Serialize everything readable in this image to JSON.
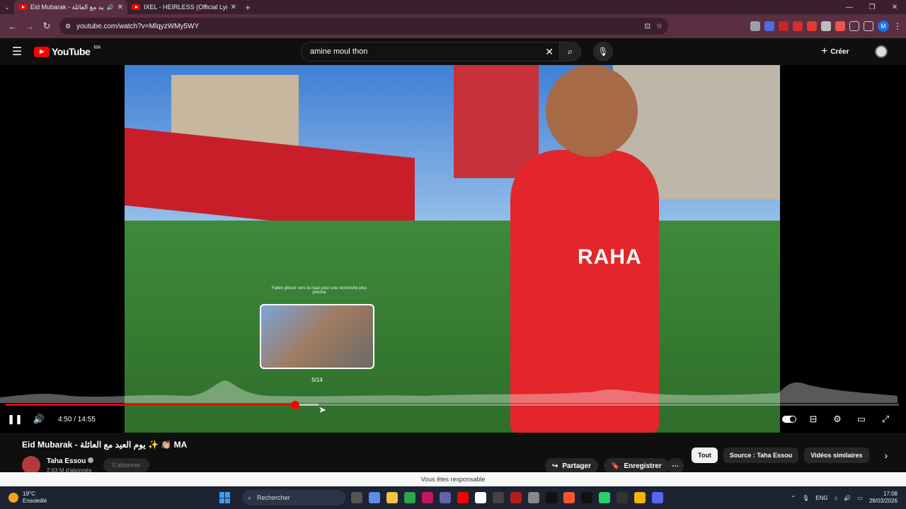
{
  "browser": {
    "tabs": [
      {
        "title": "Eid Mubarak - يوم العيد مع العائلة",
        "active": true
      },
      {
        "title": "IXEL - HEIRLESS (Official Lyric V",
        "active": false
      }
    ],
    "url": "youtube.com/watch?v=MlqyzWMy5WY",
    "profile_initial": "M"
  },
  "youtube": {
    "logo_text": "YouTube",
    "country_code": "MA",
    "search_value": "amine moul thon",
    "create_label": "Créer"
  },
  "player": {
    "hover_hint": "Faites glisser vers le haut pour une recherche plus précise",
    "preview_chapter": "5/14",
    "current_time": "4:50",
    "duration": "14:55",
    "time_display": "4:50 / 14:55",
    "progress_fraction": 0.324,
    "buffer_fraction": 0.35,
    "jersey_text": "RAHA"
  },
  "video": {
    "title": "Eid Mubarak - يوم العيد مع العائلة ✨ 👏🏼 MA",
    "channel_name": "Taha Essou",
    "subscribers": "2,63 M d'abonnés",
    "subscribe_label": "S'abonner",
    "share_label": "Partager",
    "save_label": "Enregistrer"
  },
  "chips": [
    "Tout",
    "Source : Taha Essou",
    "Vidéos similaires"
  ],
  "notice": "Vous êtes responsable",
  "taskbar": {
    "temperature": "19°C",
    "condition": "Ensoleillé",
    "search_label": "Rechercher",
    "language": "ENG",
    "time": "17:08",
    "date": "28/03/2026"
  },
  "colors": {
    "progress": "#ff0000",
    "youtube_red": "#ff0000",
    "tab_strip": "#3a1f2c",
    "toolbar": "#5a2f42"
  }
}
